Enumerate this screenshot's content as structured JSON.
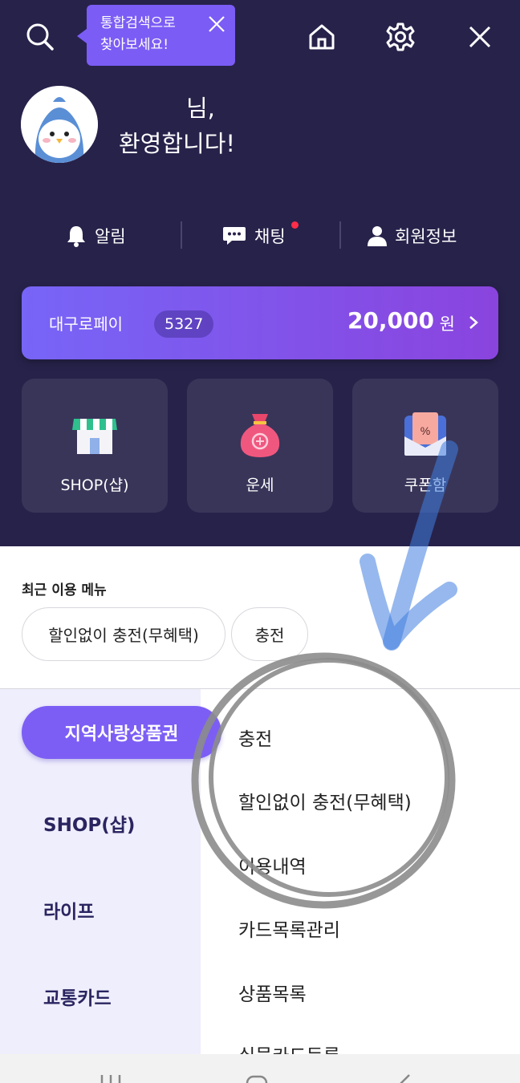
{
  "header": {
    "tooltip_line1": "통합검색으로",
    "tooltip_line2": "찾아보세요!",
    "icons": [
      "search-icon",
      "home-icon",
      "gear-icon",
      "close-icon"
    ]
  },
  "profile": {
    "name_suffix": "님,",
    "welcome": "환영합니다!"
  },
  "quick_menu": {
    "alarm": "알림",
    "chat": "채팅",
    "member": "회원정보"
  },
  "pay": {
    "name": "대구로페이",
    "number": "5327",
    "amount": "20,000",
    "unit": "원"
  },
  "cards": {
    "shop": "SHOP(샵)",
    "fortune": "운세",
    "coupon": "쿠폰함"
  },
  "recent": {
    "title": "최근 이용 메뉴",
    "chips": [
      "할인없이 충전(무혜택)",
      "충전"
    ]
  },
  "categories": {
    "active": "지역사랑상품권",
    "items": [
      "SHOP(샵)",
      "라이프",
      "교통카드"
    ]
  },
  "submenu": {
    "items": [
      "충전",
      "할인없이 충전(무혜택)",
      "이용내역",
      "카드목록관리",
      "상품목록",
      "실물카드등록"
    ]
  },
  "colors": {
    "header_bg": "#27224a",
    "accent": "#7c5ef5",
    "card_bg": "#393559",
    "nav_bg": "#efeefc",
    "notify_dot": "#ff2d4a"
  }
}
